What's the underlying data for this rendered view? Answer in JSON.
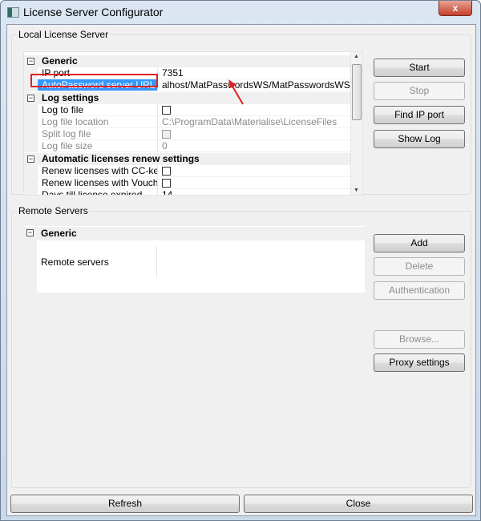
{
  "window": {
    "title": "License Server Configurator",
    "close_label": "x"
  },
  "local": {
    "group_label": "Local License Server",
    "rows": [
      {
        "type": "category",
        "label": "Generic"
      },
      {
        "type": "prop",
        "name": "IP port",
        "value": "7351"
      },
      {
        "type": "prop",
        "name": "AutoPassword server URL",
        "value": "alhost/MatPasswordsWS/MatPasswordsWS.asmx",
        "selected": true
      },
      {
        "type": "category",
        "label": "Log settings"
      },
      {
        "type": "prop",
        "name": "Log to file",
        "checkbox": true
      },
      {
        "type": "prop",
        "name": "Log file location",
        "value": "C:\\ProgramData\\Materialise\\LicenseFiles",
        "disabled": true
      },
      {
        "type": "prop",
        "name": "Split log file",
        "checkbox": true,
        "disabled": true
      },
      {
        "type": "prop",
        "name": "Log file size",
        "value": "0",
        "disabled": true
      },
      {
        "type": "category",
        "label": "Automatic licenses renew settings"
      },
      {
        "type": "prop",
        "name": "Renew licenses with CC-key",
        "checkbox": true
      },
      {
        "type": "prop",
        "name": "Renew licenses with Vouch...",
        "checkbox": true
      },
      {
        "type": "prop",
        "name": "Days till license expired",
        "value": "14"
      }
    ],
    "buttons": {
      "start": "Start",
      "stop": "Stop",
      "find_ip": "Find IP port",
      "show_log": "Show Log"
    }
  },
  "remote": {
    "group_label": "Remote Servers",
    "category": "Generic",
    "prop_name": "Remote servers",
    "buttons": {
      "add": "Add",
      "delete": "Delete",
      "auth": "Authentication",
      "browse": "Browse...",
      "proxy": "Proxy settings"
    }
  },
  "footer": {
    "refresh": "Refresh",
    "close": "Close"
  },
  "colors": {
    "selection": "#3399ff",
    "highlight_box": "#e02020"
  }
}
